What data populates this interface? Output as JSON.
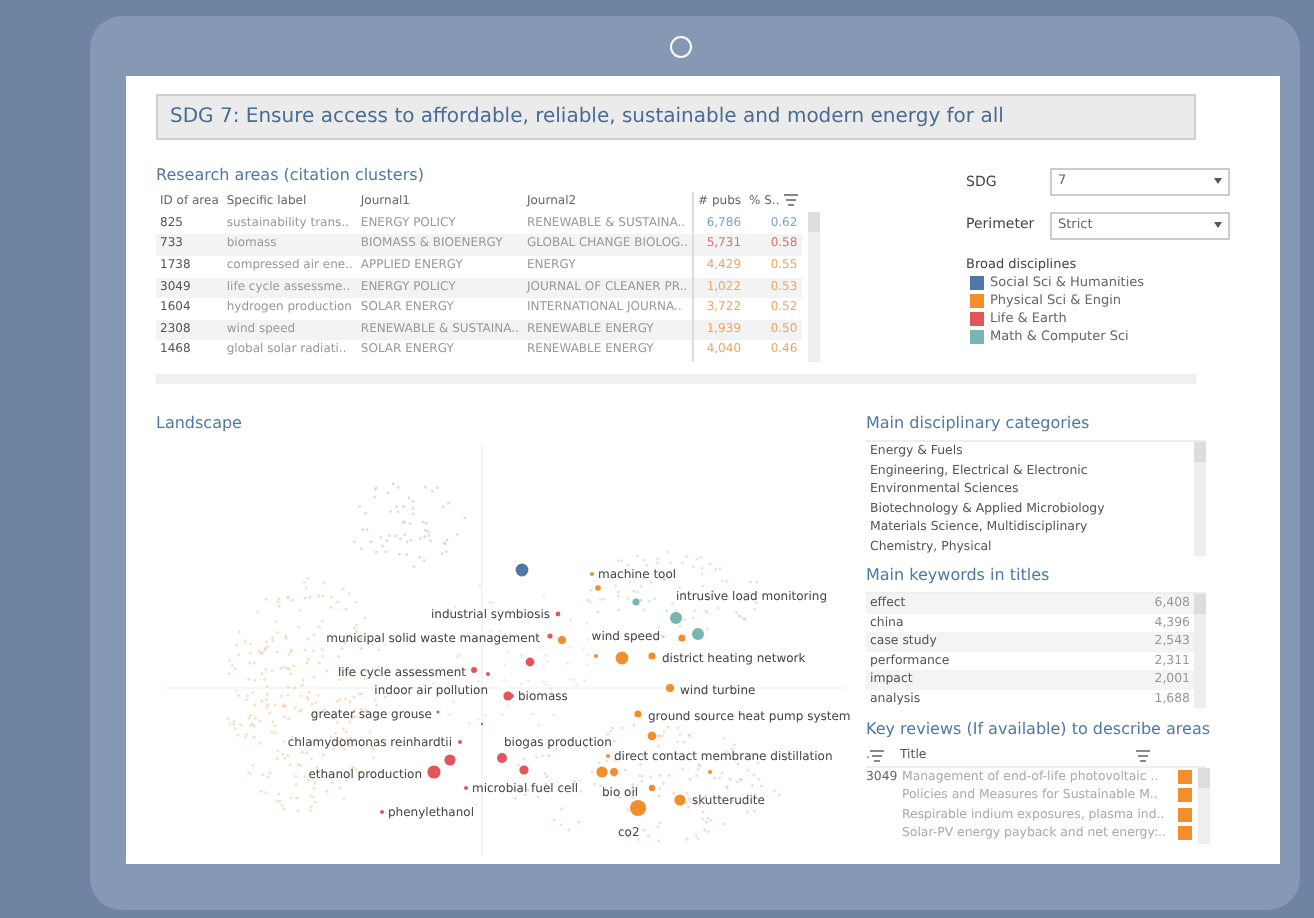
{
  "title": "SDG 7: Ensure access to affordable, reliable, sustainable and modern energy for all",
  "research_areas": {
    "heading": "Research areas (citation clusters)",
    "columns": [
      "ID of area",
      "Specific label",
      "Journal1",
      "Journal2",
      "# pubs",
      "% S.."
    ],
    "rows": [
      {
        "cells": [
          "825",
          "sustainability trans..",
          "ENERGY POLICY",
          "RENEWABLE & SUSTAINA..",
          "6,786",
          "0.62"
        ],
        "color": "#7fa3cc"
      },
      {
        "cells": [
          "733",
          "biomass",
          "BIOMASS & BIOENERGY",
          "GLOBAL CHANGE BIOLOG..",
          "5,731",
          "0.58"
        ],
        "color": "#e07070"
      },
      {
        "cells": [
          "1738",
          "compressed air ene..",
          "APPLIED ENERGY",
          "ENERGY",
          "4,429",
          "0.55"
        ],
        "color": "#f2a65a"
      },
      {
        "cells": [
          "3049",
          "life cycle assessme..",
          "ENERGY POLICY",
          "JOURNAL OF CLEANER PR..",
          "1,022",
          "0.53"
        ],
        "color": "#f2a65a"
      },
      {
        "cells": [
          "1604",
          "hydrogen production",
          "SOLAR ENERGY",
          "INTERNATIONAL JOURNA..",
          "3,722",
          "0.52"
        ],
        "color": "#f2a65a"
      },
      {
        "cells": [
          "2308",
          "wind speed",
          "RENEWABLE & SUSTAINA..",
          "RENEWABLE ENERGY",
          "1,939",
          "0.50"
        ],
        "color": "#f2a65a"
      },
      {
        "cells": [
          "1468",
          "global solar radiati..",
          "SOLAR ENERGY",
          "RENEWABLE ENERGY",
          "4,040",
          "0.46"
        ],
        "color": "#f2a65a"
      }
    ]
  },
  "filters": [
    {
      "label": "SDG",
      "value": "7"
    },
    {
      "label": "Perimeter",
      "value": "Strict"
    }
  ],
  "legend": {
    "heading": "Broad disciplines",
    "items": [
      {
        "label": "Social Sci & Humanities",
        "color": "#4e79a7"
      },
      {
        "label": "Physical Sci & Engin",
        "color": "#f28e2b"
      },
      {
        "label": "Life & Earth",
        "color": "#e15759"
      },
      {
        "label": "Math & Computer Sci",
        "color": "#76b7b2"
      }
    ]
  },
  "landscape": {
    "heading": "Landscape",
    "labels": [
      {
        "text": "machine tool",
        "color": "#f28e2b"
      },
      {
        "text": "intrusive load monitoring",
        "color": "#76b7b2"
      },
      {
        "text": "industrial symbiosis",
        "color": "#e15759"
      },
      {
        "text": "municipal solid waste management",
        "color": "#e15759"
      },
      {
        "text": "wind speed",
        "color": "#f28e2b"
      },
      {
        "text": "district heating network",
        "color": "#f28e2b"
      },
      {
        "text": "life cycle assessment",
        "color": "#e15759"
      },
      {
        "text": "indoor air pollution",
        "color": "#e15759"
      },
      {
        "text": "biomass",
        "color": "#e15759"
      },
      {
        "text": "wind turbine",
        "color": "#f28e2b"
      },
      {
        "text": "greater sage grouse",
        "color": "#e15759"
      },
      {
        "text": "ground source heat pump system",
        "color": "#f28e2b"
      },
      {
        "text": "chlamydomonas reinhardtii",
        "color": "#e15759"
      },
      {
        "text": "biogas production",
        "color": "#e15759"
      },
      {
        "text": "direct contact membrane distillation",
        "color": "#f28e2b"
      },
      {
        "text": "ethanol production",
        "color": "#e15759"
      },
      {
        "text": "microbial fuel cell",
        "color": "#e15759"
      },
      {
        "text": "bio oil",
        "color": "#f28e2b"
      },
      {
        "text": "skutterudite",
        "color": "#f28e2b"
      },
      {
        "text": "phenylethanol",
        "color": "#e15759"
      },
      {
        "text": "co2",
        "color": "#f28e2b"
      }
    ]
  },
  "categories": {
    "heading": "Main disciplinary categories",
    "items": [
      "Energy & Fuels",
      "Engineering, Electrical & Electronic",
      "Environmental Sciences",
      "Biotechnology & Applied Microbiology",
      "Materials Science, Multidisciplinary",
      "Chemistry, Physical"
    ]
  },
  "keywords": {
    "heading": "Main keywords in titles",
    "rows": [
      {
        "word": "effect",
        "count": "6,408"
      },
      {
        "word": "china",
        "count": "4,396"
      },
      {
        "word": "case study",
        "count": "2,543"
      },
      {
        "word": "performance",
        "count": "2,311"
      },
      {
        "word": "impact",
        "count": "2,001"
      },
      {
        "word": "analysis",
        "count": "1,688"
      }
    ]
  },
  "reviews": {
    "heading": "Key reviews (If available) to describe areas",
    "columns": [
      ".",
      "Title"
    ],
    "rows": [
      {
        "id": "3049",
        "title": "Management of end-of-life photovoltaic ..",
        "color": "#f28e2b"
      },
      {
        "title": "Policies and Measures for Sustainable M..",
        "color": "#f28e2b"
      },
      {
        "title": "Respirable indium exposures, plasma ind..",
        "color": "#f28e2b"
      },
      {
        "title": "Solar-PV energy payback and net energy:..",
        "color": "#f28e2b"
      }
    ]
  }
}
